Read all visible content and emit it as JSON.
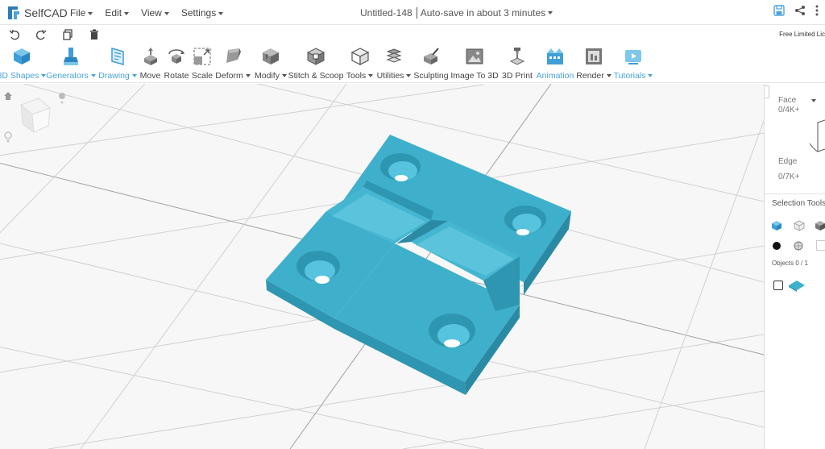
{
  "app": {
    "name": "SelfCAD"
  },
  "menu": [
    {
      "label": "File"
    },
    {
      "label": "Edit"
    },
    {
      "label": "View"
    },
    {
      "label": "Settings"
    }
  ],
  "document": {
    "title": "Untitled-148",
    "autosave": "Auto-save in about 3 minutes"
  },
  "license": "Free Limited Lic",
  "toolbar": [
    {
      "label": "3D Shapes",
      "dropdown": true,
      "blue": true
    },
    {
      "label": "Generators",
      "dropdown": true,
      "blue": true
    },
    {
      "label": "Drawing",
      "dropdown": true,
      "blue": true
    },
    {
      "label": "Move",
      "dropdown": false,
      "blue": false
    },
    {
      "label": "Rotate",
      "dropdown": false,
      "blue": false
    },
    {
      "label": "Scale",
      "dropdown": false,
      "blue": false
    },
    {
      "label": "Deform",
      "dropdown": true,
      "blue": false
    },
    {
      "label": "Modify",
      "dropdown": true,
      "blue": false
    },
    {
      "label": "Stitch & Scoop",
      "dropdown": false,
      "blue": false
    },
    {
      "label": "Tools",
      "dropdown": true,
      "blue": false
    },
    {
      "label": "Utilities",
      "dropdown": true,
      "blue": false
    },
    {
      "label": "Sculpting",
      "dropdown": false,
      "blue": false
    },
    {
      "label": "Image To 3D",
      "dropdown": false,
      "blue": false
    },
    {
      "label": "3D Print",
      "dropdown": false,
      "blue": false
    },
    {
      "label": "Animation",
      "dropdown": false,
      "blue": true
    },
    {
      "label": "Render",
      "dropdown": true,
      "blue": false
    },
    {
      "label": "Tutorials",
      "dropdown": true,
      "blue": true
    }
  ],
  "panel": {
    "face_label": "Face",
    "face_count": "0/4K+",
    "edge_label": "Edge",
    "edge_count": "0/7K+",
    "selection_tools": "Selection Tools",
    "objects": "Objects 0 / 1"
  },
  "colors": {
    "accent": "#4aa3df",
    "model": "#3fb0cc",
    "model_side": "#2e96b0"
  }
}
